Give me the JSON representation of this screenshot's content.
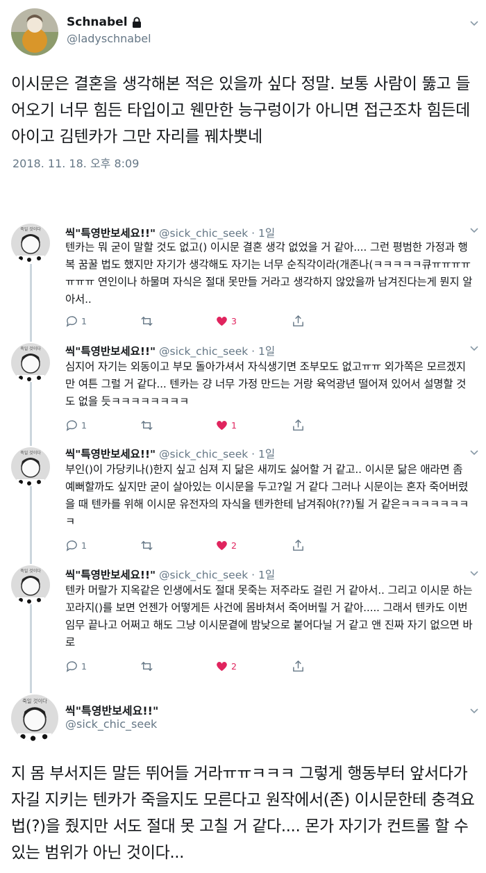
{
  "tweet": {
    "author_name": "Schnabel",
    "author_handle": "@ladyschnabel",
    "text": "이시문은 결혼을 생각해본 적은 있을까 싶다 정말. 보통 사람이 뚫고 들어오기 너무 힘든 타입이고 웬만한 능구렁이가 아니면 접근조차 힘든데 아이고 김텐카가 그만 자리를 꿰차뿟네",
    "timestamp": "2018. 11. 18. 오후 8:09"
  },
  "replies": [
    {
      "name": "씩\"특영반보세요!!\"",
      "meta": "@sick_chic_seek · 1일",
      "text": "텐카는 뭐 굳이 말할 것도 없고() 이시문 결혼 생각 없었을 거 같아.... 그런 평범한 가정과 행복 꿈꿀 법도 했지만 자기가 생각해도 자기는 너무 순직각이라(개존나(ㅋㅋㅋㅋㅋ큐ㅠㅠㅠㅠㅠㅠㅠ 연인이나 하물며 자식은 절대 못만들 거라고 생각하지 않았을까 남겨진다는게 뭔지 알아서..",
      "reply_count": "1",
      "retweet_count": "",
      "like_count": "3"
    },
    {
      "name": "씩\"특영반보세요!!\"",
      "meta": "@sick_chic_seek · 1일",
      "text": "심지어 자기는 외동이고 부모 돌아가셔서 자식생기면 조부모도 없고ㅠㅠ 외가쪽은 모르겠지만 여튼 그럴 거 같다... 텐카는 걍 너무 가정 만드는 거랑 육억광년 떨어져 있어서 설명할 것도 없을 듯ㅋㅋㅋㅋㅋㅋㅋㅋ",
      "reply_count": "1",
      "retweet_count": "",
      "like_count": "1"
    },
    {
      "name": "씩\"특영반보세요!!\"",
      "meta": "@sick_chic_seek · 1일",
      "text": "부인()이 가당키나()한지 싶고 심져 지 닮은 새끼도 싫어할 거 같고.. 이시문 닮은 애라면 좀 예뻐할까도 싶지만 굳이 살아있는 이시문을 두고?일 거 같다 그러나 시문이는 혼자 죽어버렸을 때 텐카를 위해 이시문 유전자의 자식을 텐카한테 남겨줘야(??)될 거 같은ㅋㅋㅋㅋㅋㅋㅋㅋ",
      "reply_count": "1",
      "retweet_count": "",
      "like_count": "2"
    },
    {
      "name": "씩\"특영반보세요!!\"",
      "meta": "@sick_chic_seek · 1일",
      "text": "텐카 머랄가 지옥같은 인생에서도 절대 못죽는 저주라도 걸린 거 같아서.. 그리고 이시문 하는 꼬라지()를 보면 언젠가 어떻게든 사건에 몸바쳐서 죽어버릴 거 같아..... 그래서 텐카도 이번 임무 끝나고 어쩌고 해도 그냥 이시문곁에 밤낮으로 붙어다닐 거 같고 앤 진짜 자기 없으면 바로",
      "reply_count": "1",
      "retweet_count": "",
      "like_count": "2"
    }
  ],
  "final_tweet": {
    "name": "씩\"특영반보세요!!\"",
    "handle": "@sick_chic_seek",
    "text": "지 몸 부서지든 말든 뛰어들 거라ㅠㅠㅋㅋㅋ 그렇게 행동부터 앞서다가 자길 지키는 텐카가 죽을지도 모른다고 원작에서(존) 이시문한테 충격요법(?)을 줬지만 서도 절대 못 고칠 거 같다.... 몬가 자기가 컨트롤 할 수 있는 범위가 아닌 것이다..."
  },
  "colors": {
    "secondary": "#657786",
    "like": "#e0245e",
    "thread_line": "#ccd6dd"
  }
}
